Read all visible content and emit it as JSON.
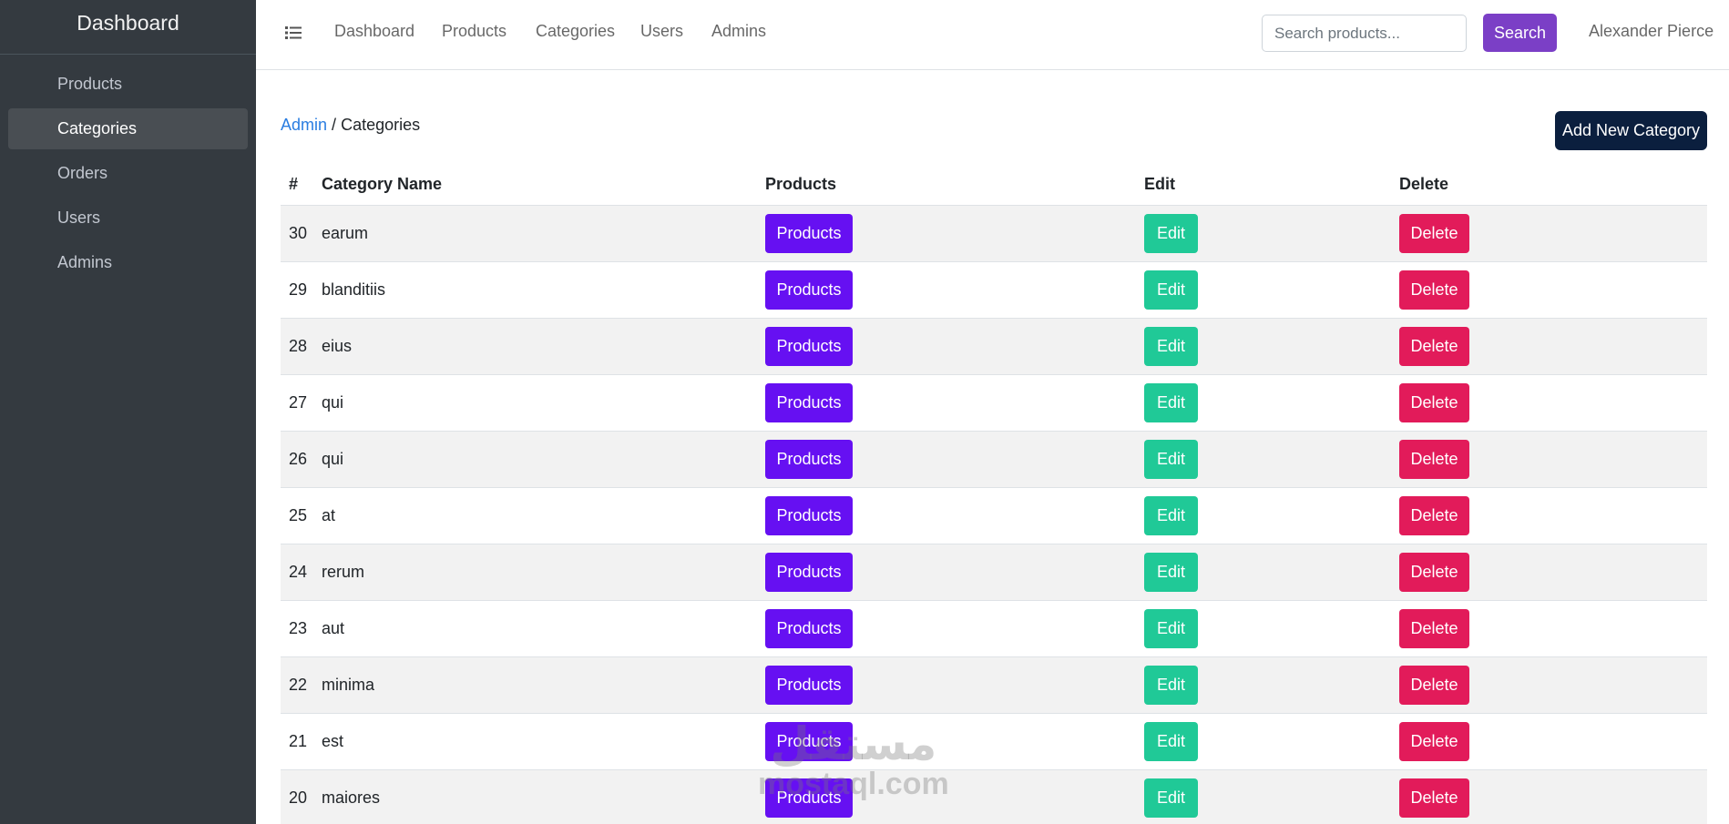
{
  "sidebar": {
    "brand": "Dashboard",
    "items": [
      {
        "label": "Products"
      },
      {
        "label": "Categories",
        "active": true
      },
      {
        "label": "Orders"
      },
      {
        "label": "Users"
      },
      {
        "label": "Admins"
      }
    ]
  },
  "topbar": {
    "menu_icon": "list-icon",
    "links": [
      "Dashboard",
      "Products",
      "Categories",
      "Users",
      "Admins"
    ],
    "search": {
      "placeholder": "Search products...",
      "value": ""
    },
    "search_button": "Search",
    "user": "Alexander Pierce"
  },
  "breadcrumb": {
    "root": "Admin",
    "separator": "/",
    "current": "Categories"
  },
  "add_button": "Add New Category",
  "table": {
    "headers": [
      "#",
      "Category Name",
      "Products",
      "Edit",
      "Delete"
    ],
    "rows": [
      {
        "id": "30",
        "name": "earum",
        "products": "Products",
        "edit": "Edit",
        "delete": "Delete"
      },
      {
        "id": "29",
        "name": "blanditiis",
        "products": "Products",
        "edit": "Edit",
        "delete": "Delete"
      },
      {
        "id": "28",
        "name": "eius",
        "products": "Products",
        "edit": "Edit",
        "delete": "Delete"
      },
      {
        "id": "27",
        "name": "qui",
        "products": "Products",
        "edit": "Edit",
        "delete": "Delete"
      },
      {
        "id": "26",
        "name": "qui",
        "products": "Products",
        "edit": "Edit",
        "delete": "Delete"
      },
      {
        "id": "25",
        "name": "at",
        "products": "Products",
        "edit": "Edit",
        "delete": "Delete"
      },
      {
        "id": "24",
        "name": "rerum",
        "products": "Products",
        "edit": "Edit",
        "delete": "Delete"
      },
      {
        "id": "23",
        "name": "aut",
        "products": "Products",
        "edit": "Edit",
        "delete": "Delete"
      },
      {
        "id": "22",
        "name": "minima",
        "products": "Products",
        "edit": "Edit",
        "delete": "Delete"
      },
      {
        "id": "21",
        "name": "est",
        "products": "Products",
        "edit": "Edit",
        "delete": "Delete"
      },
      {
        "id": "20",
        "name": "maiores",
        "products": "Products",
        "edit": "Edit",
        "delete": "Delete"
      }
    ]
  },
  "watermark": {
    "arabic": "مستقل",
    "latin": "mostaql.com"
  },
  "colors": {
    "sidebar_bg": "#343a40",
    "products_button": "#6610f2",
    "edit_button": "#20c997",
    "delete_button": "#e21b5a",
    "search_button": "#7b3fc6",
    "add_button": "#0b1f3e",
    "breadcrumb_link": "#2a7de1"
  }
}
